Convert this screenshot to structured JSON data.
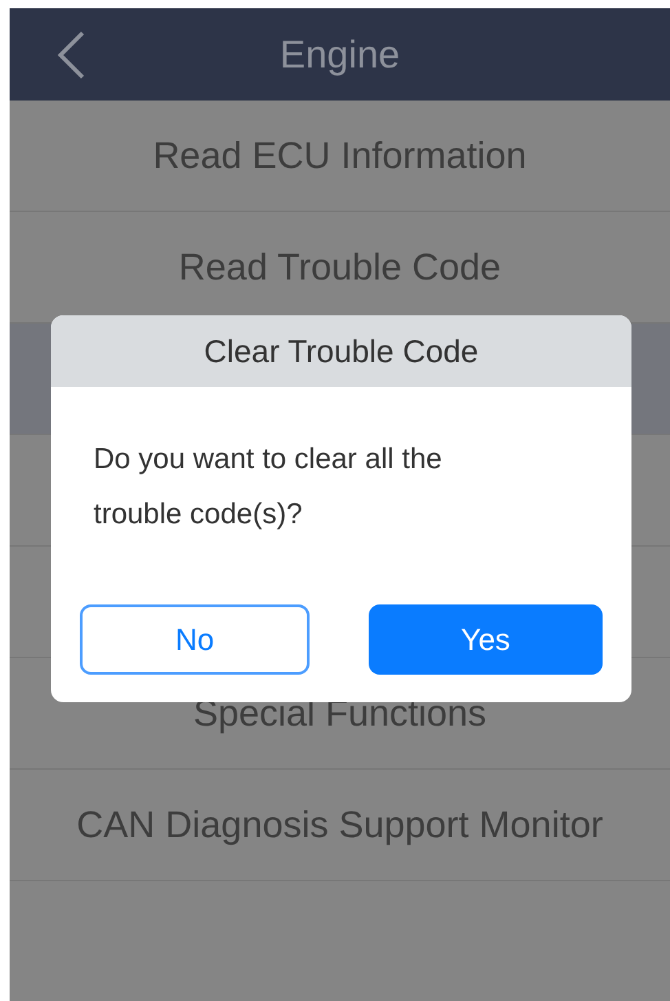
{
  "header": {
    "title": "Engine"
  },
  "menu_items": [
    {
      "label": "Read ECU Information",
      "selected": false
    },
    {
      "label": "Read Trouble Code",
      "selected": false
    },
    {
      "selected": true
    },
    {
      "selected": false
    },
    {
      "selected": false
    },
    {
      "label": "Special Functions",
      "selected": false
    },
    {
      "label": "CAN Diagnosis Support Monitor",
      "selected": false
    }
  ],
  "dialog": {
    "title": "Clear Trouble Code",
    "message": "Do you want to clear all the trouble code(s)?",
    "buttons": [
      {
        "label": "No",
        "kind": "secondary"
      },
      {
        "label": "Yes",
        "kind": "primary"
      }
    ]
  }
}
